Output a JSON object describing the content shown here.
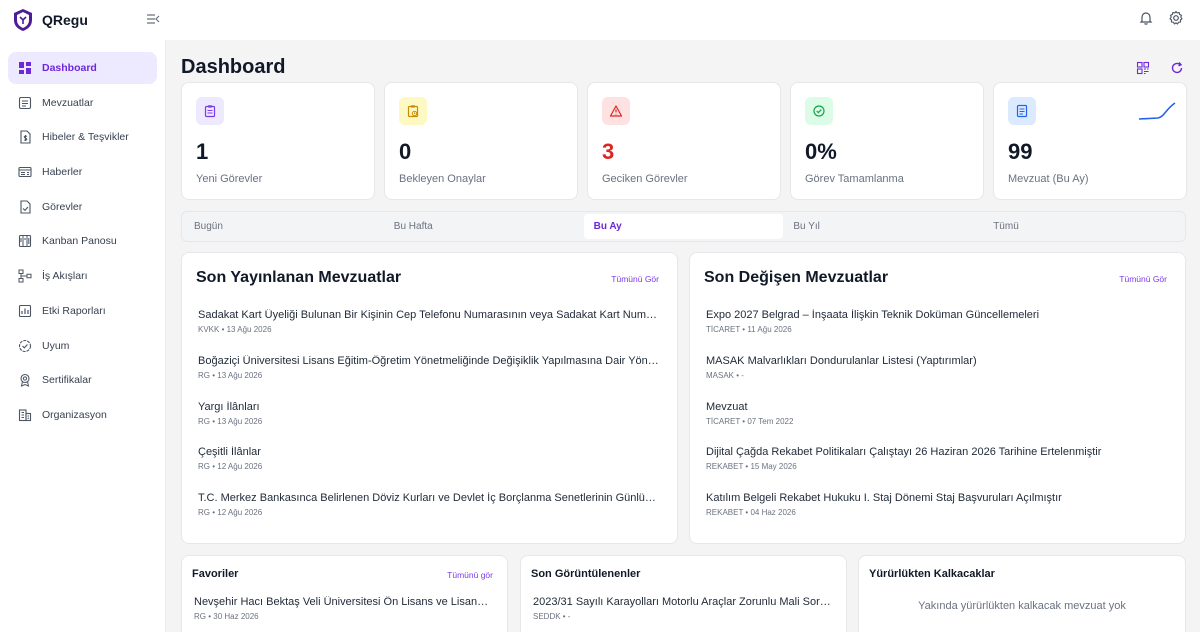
{
  "app": {
    "name": "QRegu"
  },
  "colors": {
    "accent": "#6d28d9",
    "danger": "#dc2626",
    "sidebar_active_bg": "#ede9fe"
  },
  "sidebar": {
    "items": [
      {
        "label": "Dashboard",
        "icon": "grid-icon",
        "active": true
      },
      {
        "label": "Mevzuatlar",
        "icon": "document-list-icon"
      },
      {
        "label": "Hibeler & Teşvikler",
        "icon": "money-document-icon"
      },
      {
        "label": "Haberler",
        "icon": "newspaper-icon"
      },
      {
        "label": "Görevler",
        "icon": "task-file-icon"
      },
      {
        "label": "Kanban Panosu",
        "icon": "kanban-icon"
      },
      {
        "label": "İş Akışları",
        "icon": "workflow-icon"
      },
      {
        "label": "Etki Raporları",
        "icon": "report-chart-icon"
      },
      {
        "label": "Uyum",
        "icon": "compliance-check-icon"
      },
      {
        "label": "Sertifikalar",
        "icon": "certificate-icon"
      },
      {
        "label": "Organizasyon",
        "icon": "building-icon"
      }
    ]
  },
  "header": {
    "title": "Dashboard"
  },
  "stats": [
    {
      "value": "1",
      "label": "Yeni Görevler",
      "icon": "clipboard-icon"
    },
    {
      "value": "0",
      "label": "Bekleyen Onaylar",
      "icon": "clipboard-clock-icon"
    },
    {
      "value": "3",
      "label": "Geciken Görevler",
      "icon": "warning-icon"
    },
    {
      "value": "0%",
      "label": "Görev Tamamlanma",
      "icon": "check-circle-icon"
    },
    {
      "value": "99",
      "label": "Mevzuat (Bu Ay)",
      "icon": "document-icon"
    }
  ],
  "tabs": [
    {
      "label": "Bugün"
    },
    {
      "label": "Bu Hafta"
    },
    {
      "label": "Bu Ay",
      "active": true
    },
    {
      "label": "Bu Yıl"
    },
    {
      "label": "Tümü"
    }
  ],
  "recent_published": {
    "title": "Son Yayınlanan Mevzuatlar",
    "link": "Tümünü Gör",
    "items": [
      {
        "title": "Sadakat Kart Üyeliği Bulunan Bir Kişinin Cep Telefonu Numarasının veya Sadakat Kart Numarası",
        "meta": "KVKK • 13 Ağu 2026"
      },
      {
        "title": "Boğaziçi Üniversitesi Lisans Eğitim-Öğretim Yönetmeliğinde Değişiklik Yapılmasına Dair Yönetmelik",
        "meta": "RG • 13 Ağu 2026"
      },
      {
        "title": "Yargı İlânları",
        "meta": "RG • 13 Ağu 2026"
      },
      {
        "title": "Çeşitli İlânlar",
        "meta": "RG • 12 Ağu 2026"
      },
      {
        "title": "T.C. Merkez Bankasınca Belirlenen Döviz Kurları ve Devlet İç Borçlanma Senetlerinin Günlük Fiyatları",
        "meta": "RG • 12 Ağu 2026"
      }
    ]
  },
  "recent_changed": {
    "title": "Son Değişen Mevzuatlar",
    "link": "Tümünü Gör",
    "items": [
      {
        "title": "Expo 2027 Belgrad – İnşaata İlişkin Teknik Doküman Güncellemeleri",
        "meta": "TİCARET • 11 Ağu 2026"
      },
      {
        "title": "MASAK Malvarlıkları Dondurulanlar Listesi (Yaptırımlar)",
        "meta": "MASAK • -"
      },
      {
        "title": "Mevzuat",
        "meta": "TİCARET • 07 Tem 2022"
      },
      {
        "title": "Dijital Çağda Rekabet Politikaları Çalıştayı 26 Haziran 2026 Tarihine Ertelenmiştir",
        "meta": "REKABET • 15 May 2026"
      },
      {
        "title": "Katılım Belgeli Rekabet Hukuku I. Staj Dönemi Staj Başvuruları Açılmıştır",
        "meta": "REKABET • 04 Haz 2026"
      }
    ]
  },
  "favorites": {
    "title": "Favoriler",
    "link": "Tümünü gör",
    "items": [
      {
        "title": "Nevşehir Hacı Bektaş Veli Üniversitesi Ön Lisans ve Lisans Eğitim-Öğretim Yönetmeliği",
        "meta": "RG • 30 Haz 2026"
      }
    ]
  },
  "recently_viewed": {
    "title": "Son Görüntülenenler",
    "items": [
      {
        "title": "2023/31 Sayılı Karayolları Motorlu Araçlar Zorunlu Mali Sorumluluk Sigortası",
        "meta": "SEDDK • -"
      }
    ]
  },
  "expiring": {
    "title": "Yürürlükten Kalkacaklar",
    "empty_text": "Yakında yürürlükten kalkacak mevzuat yok"
  }
}
